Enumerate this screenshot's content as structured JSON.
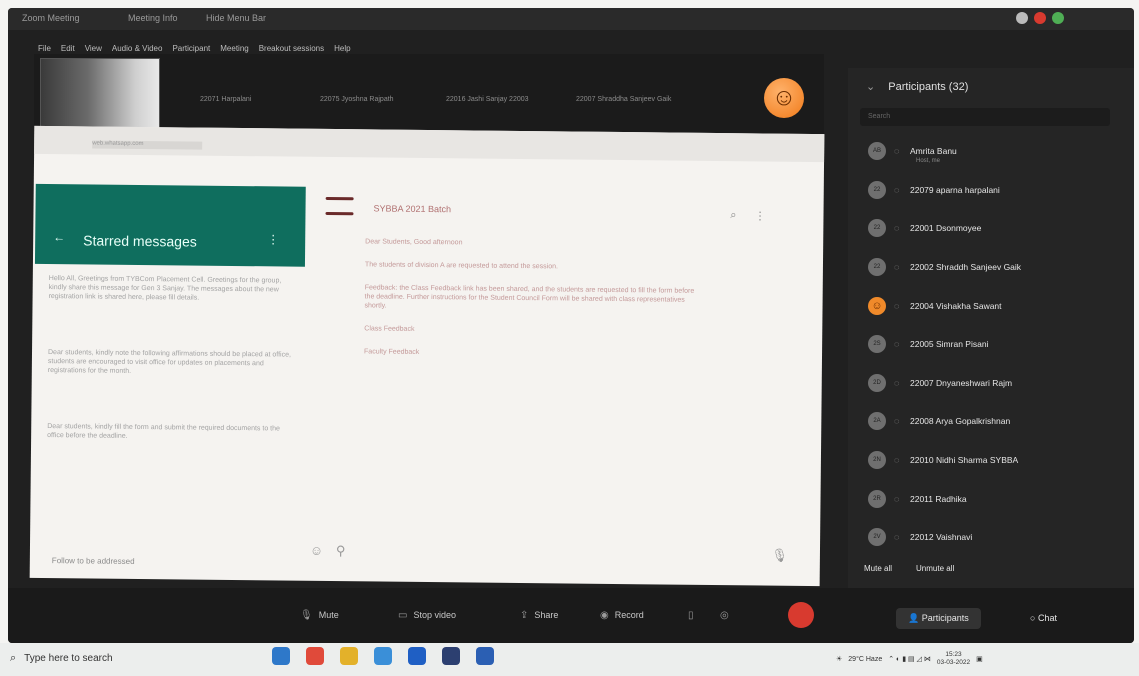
{
  "titlebar": {
    "tabs": [
      "Zoom Meeting",
      "Meeting Info",
      "Hide Menu Bar"
    ]
  },
  "menubar": {
    "items": [
      "File",
      "Edit",
      "View",
      "Audio & Video",
      "Participant",
      "Meeting",
      "Breakout sessions",
      "Help"
    ]
  },
  "thumbnails": {
    "labels": [
      "22071 Harpalani",
      "22075 Jyoshna Rajpath",
      "22016 Jashi Sanjay 22003",
      "22007 Shraddha Sanjeev Gaik"
    ]
  },
  "whatsapp": {
    "browser_address": "web.whatsapp.com",
    "starred_title": "Starred messages",
    "back_icon": "←",
    "menu_icon": "⋮",
    "starred_messages": [
      "Hello All, Greetings from TYBCom Placement Cell. Greetings for the group, kindly share this message for Gen 3 Sanjay. The messages about the new registration link is shared here, please fill details.",
      "Dear students, kindly note the following affirmations should be placed at office, students are encouraged to visit office for updates on placements and registrations for the month.",
      "Dear students, kindly fill the form and submit the required documents to the office before the deadline."
    ],
    "starred_footer": "Follow to be addressed",
    "chat_title": "SYBBA 2021 Batch",
    "chat_messages": [
      "Dear Students, Good afternoon",
      "The students of division A are requested to attend the session.",
      "Feedback: the Class Feedback link has been shared, and the students are requested to fill the form before the deadline. Further instructions for the Student Council Form will be shared with class representatives shortly.",
      "Class Feedback",
      "Faculty Feedback"
    ]
  },
  "participants": {
    "header": "Participants (32)",
    "search_placeholder": "Search",
    "list": [
      {
        "initials": "AB",
        "name": "Amrita Banu",
        "sub": "Host, me"
      },
      {
        "initials": "22",
        "name": "22079 aparna harpalani",
        "sub": ""
      },
      {
        "initials": "22",
        "name": "22001 Dsonmoyee",
        "sub": ""
      },
      {
        "initials": "22",
        "name": "22002 Shraddh Sanjeev Gaik",
        "sub": ""
      },
      {
        "initials": "emoji",
        "name": "22004 Vishakha Sawant",
        "sub": ""
      },
      {
        "initials": "2S",
        "name": "22005 Simran Pisani",
        "sub": ""
      },
      {
        "initials": "2D",
        "name": "22007 Dnyaneshwari Rajm",
        "sub": ""
      },
      {
        "initials": "2A",
        "name": "22008 Arya Gopalkrishnan",
        "sub": ""
      },
      {
        "initials": "2N",
        "name": "22010 Nidhi Sharma SYBBA",
        "sub": ""
      },
      {
        "initials": "2R",
        "name": "22011 Radhika",
        "sub": ""
      },
      {
        "initials": "2V",
        "name": "22012 Vaishnavi",
        "sub": ""
      }
    ],
    "mute_all": "Mute all",
    "unmute_all": "Unmute all"
  },
  "toolbar": {
    "mute": "Mute",
    "stop_video": "Stop video",
    "share": "Share",
    "record": "Record",
    "participants": "Participants",
    "chat": "Chat"
  },
  "taskbar": {
    "search": "Type here to search",
    "weather": "29°C Haze",
    "time": "15:23",
    "date": "03-03-2022"
  },
  "colors": {
    "whatsapp_green": "#0f6e5e",
    "end_red": "#d83a2f",
    "zoom_dark": "#202020"
  }
}
